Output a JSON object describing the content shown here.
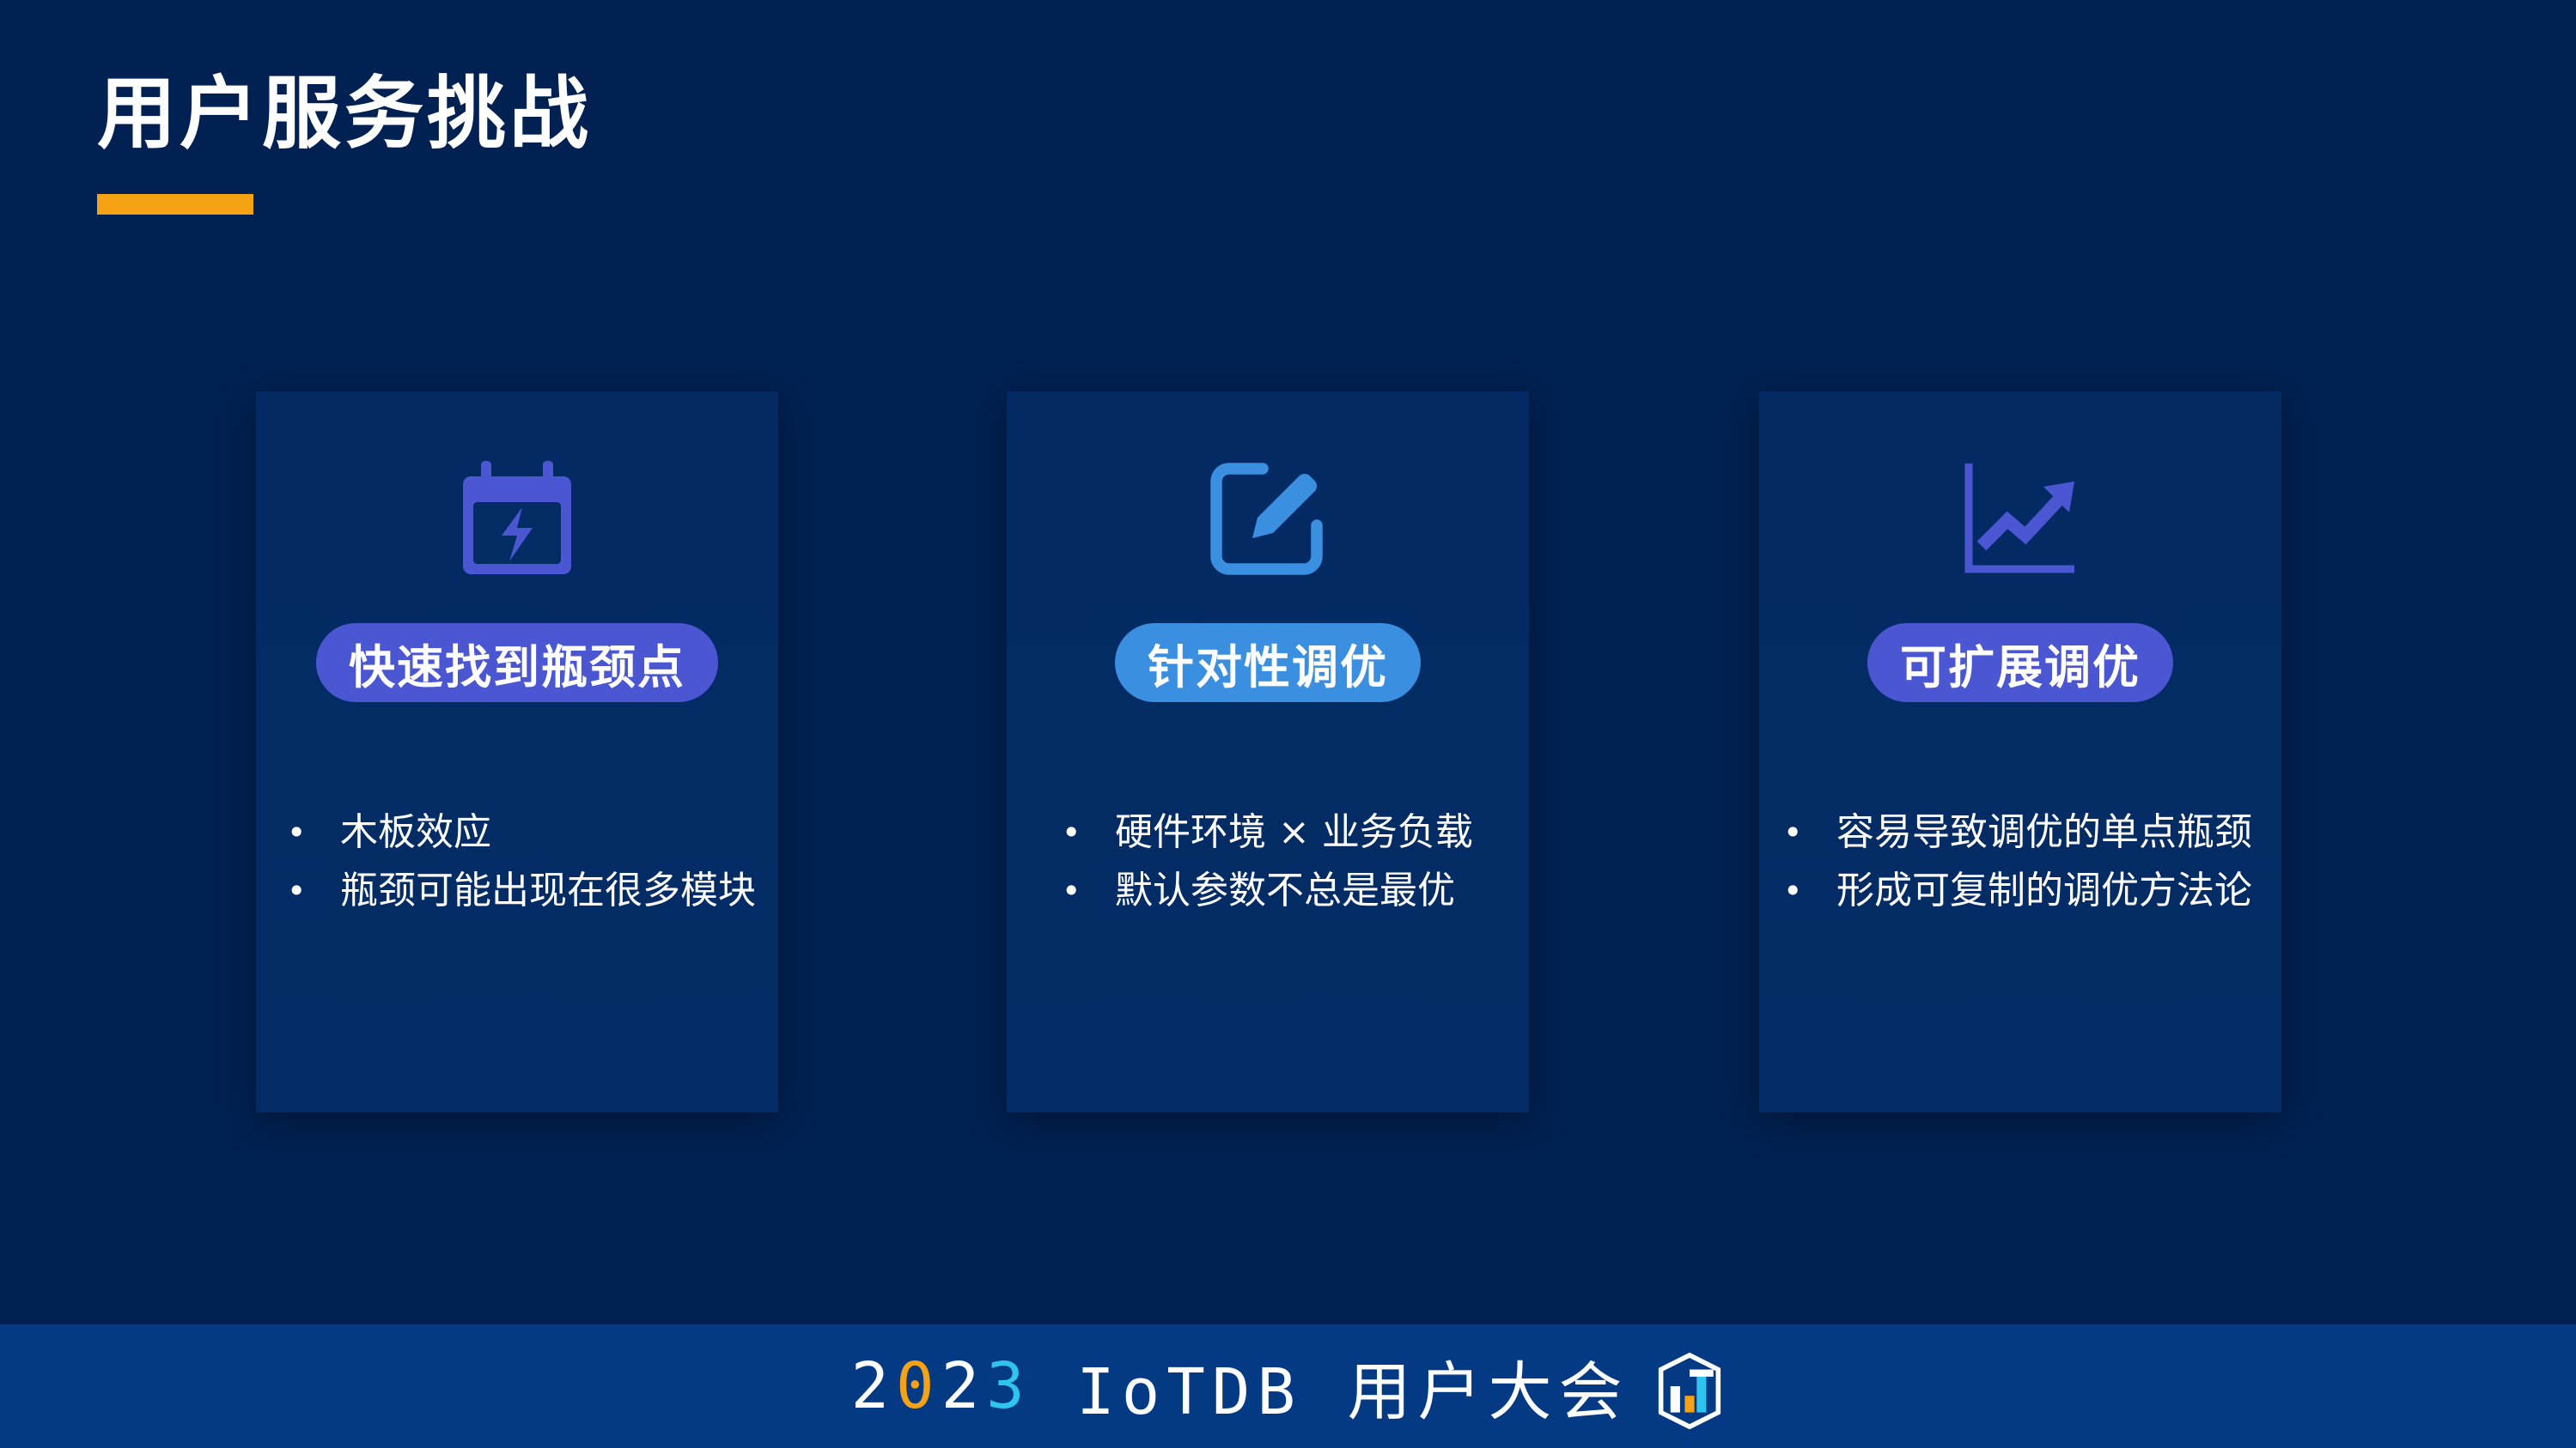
{
  "title": "用户服务挑战",
  "colors": {
    "background": "#012152",
    "card": "#032B64",
    "accent_orange": "#F5A314",
    "pill_purple": "#4B56D2",
    "pill_blue": "#3A8FE0",
    "footer": "#043A83",
    "digit_cyan": "#2FC4F0"
  },
  "cards": [
    {
      "icon": "calendar-lightning-icon",
      "label": "快速找到瓶颈点",
      "bullets": [
        "木板效应",
        "瓶颈可能出现在很多模块"
      ]
    },
    {
      "icon": "edit-square-icon",
      "label": "针对性调优",
      "bullets": [
        "硬件环境 × 业务负载",
        "默认参数不总是最优"
      ]
    },
    {
      "icon": "trending-up-chart-icon",
      "label": "可扩展调优",
      "bullets": [
        "容易导致调优的单点瓶颈",
        "形成可复制的调优方法论"
      ]
    }
  ],
  "footer": {
    "digit_1": "2",
    "digit_2": "0",
    "digit_3": "2",
    "digit_4": "3",
    "rest": " IoTDB 用户大会",
    "logo": "iotdb-logo-icon"
  }
}
